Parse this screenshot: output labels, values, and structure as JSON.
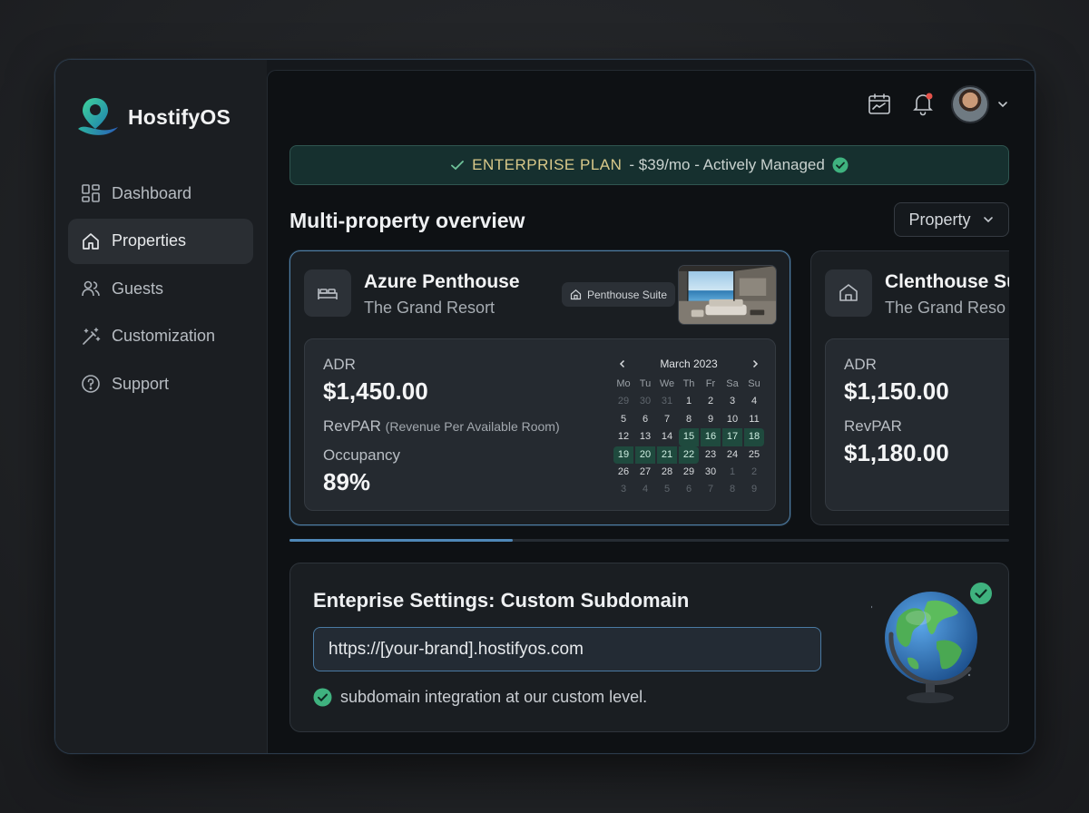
{
  "app": {
    "name": "HostifyOS"
  },
  "sidebar": {
    "items": [
      {
        "label": "Dashboard",
        "icon": "dashboard-icon",
        "active": false
      },
      {
        "label": "Properties",
        "icon": "home-icon",
        "active": true
      },
      {
        "label": "Guests",
        "icon": "users-icon",
        "active": false
      },
      {
        "label": "Customization",
        "icon": "magic-wand-icon",
        "active": false
      },
      {
        "label": "Support",
        "icon": "help-circle-icon",
        "active": false
      }
    ]
  },
  "header": {
    "icons": [
      "calendar-chart-icon",
      "bell-icon",
      "avatar",
      "chevron-down-icon"
    ],
    "notification_dot_color": "#e5534b"
  },
  "banner": {
    "plan": "ENTERPRISE PLAN",
    "details": "- $39/mo - Actively Managed"
  },
  "overview": {
    "title": "Multi-property overview",
    "filter_label": "Property"
  },
  "properties": [
    {
      "name": "Azure Penthouse",
      "resort": "The Grand Resort",
      "badge": "Penthouse Suite",
      "adr_label": "ADR",
      "adr_value": "$1,450.00",
      "revpar_label": "RevPAR",
      "revpar_note": "(Revenue Per Available Room)",
      "occupancy_label": "Occupancy",
      "occupancy_value": "89%"
    },
    {
      "name": "Clenthouse Su",
      "resort": "The Grand Reso",
      "adr_label": "ADR",
      "adr_value": "$1,150.00",
      "revpar_label": "RevPAR",
      "revpar_value": "$1,180.00"
    }
  ],
  "calendar": {
    "month": "March 2023",
    "weekdays": [
      "Mo",
      "Tu",
      "We",
      "Th",
      "Fr",
      "Sa",
      "Su"
    ],
    "weeks": [
      [
        "29",
        "30",
        "31",
        "1",
        "2",
        "3",
        "4"
      ],
      [
        "5",
        "6",
        "7",
        "8",
        "9",
        "10",
        "11"
      ],
      [
        "12",
        "13",
        "14",
        "15",
        "16",
        "17",
        "18"
      ],
      [
        "19",
        "20",
        "21",
        "22",
        "23",
        "24",
        "25"
      ],
      [
        "26",
        "27",
        "28",
        "29",
        "30",
        "1",
        "2"
      ],
      [
        "3",
        "4",
        "5",
        "6",
        "7",
        "8",
        "9"
      ]
    ],
    "selected_range": [
      "15",
      "22"
    ]
  },
  "carousel": {
    "scroll_fraction": 0.31
  },
  "settings": {
    "title": "Enteprise Settings: Custom Subdomain",
    "subdomain_value": "https://[your-brand].hostifyos.com",
    "note": "subdomain integration at our custom level."
  },
  "colors": {
    "accent": "#4f88b8",
    "success": "#3fb27f",
    "banner_bg": "#16302f",
    "plan_text": "#d9c98a"
  }
}
